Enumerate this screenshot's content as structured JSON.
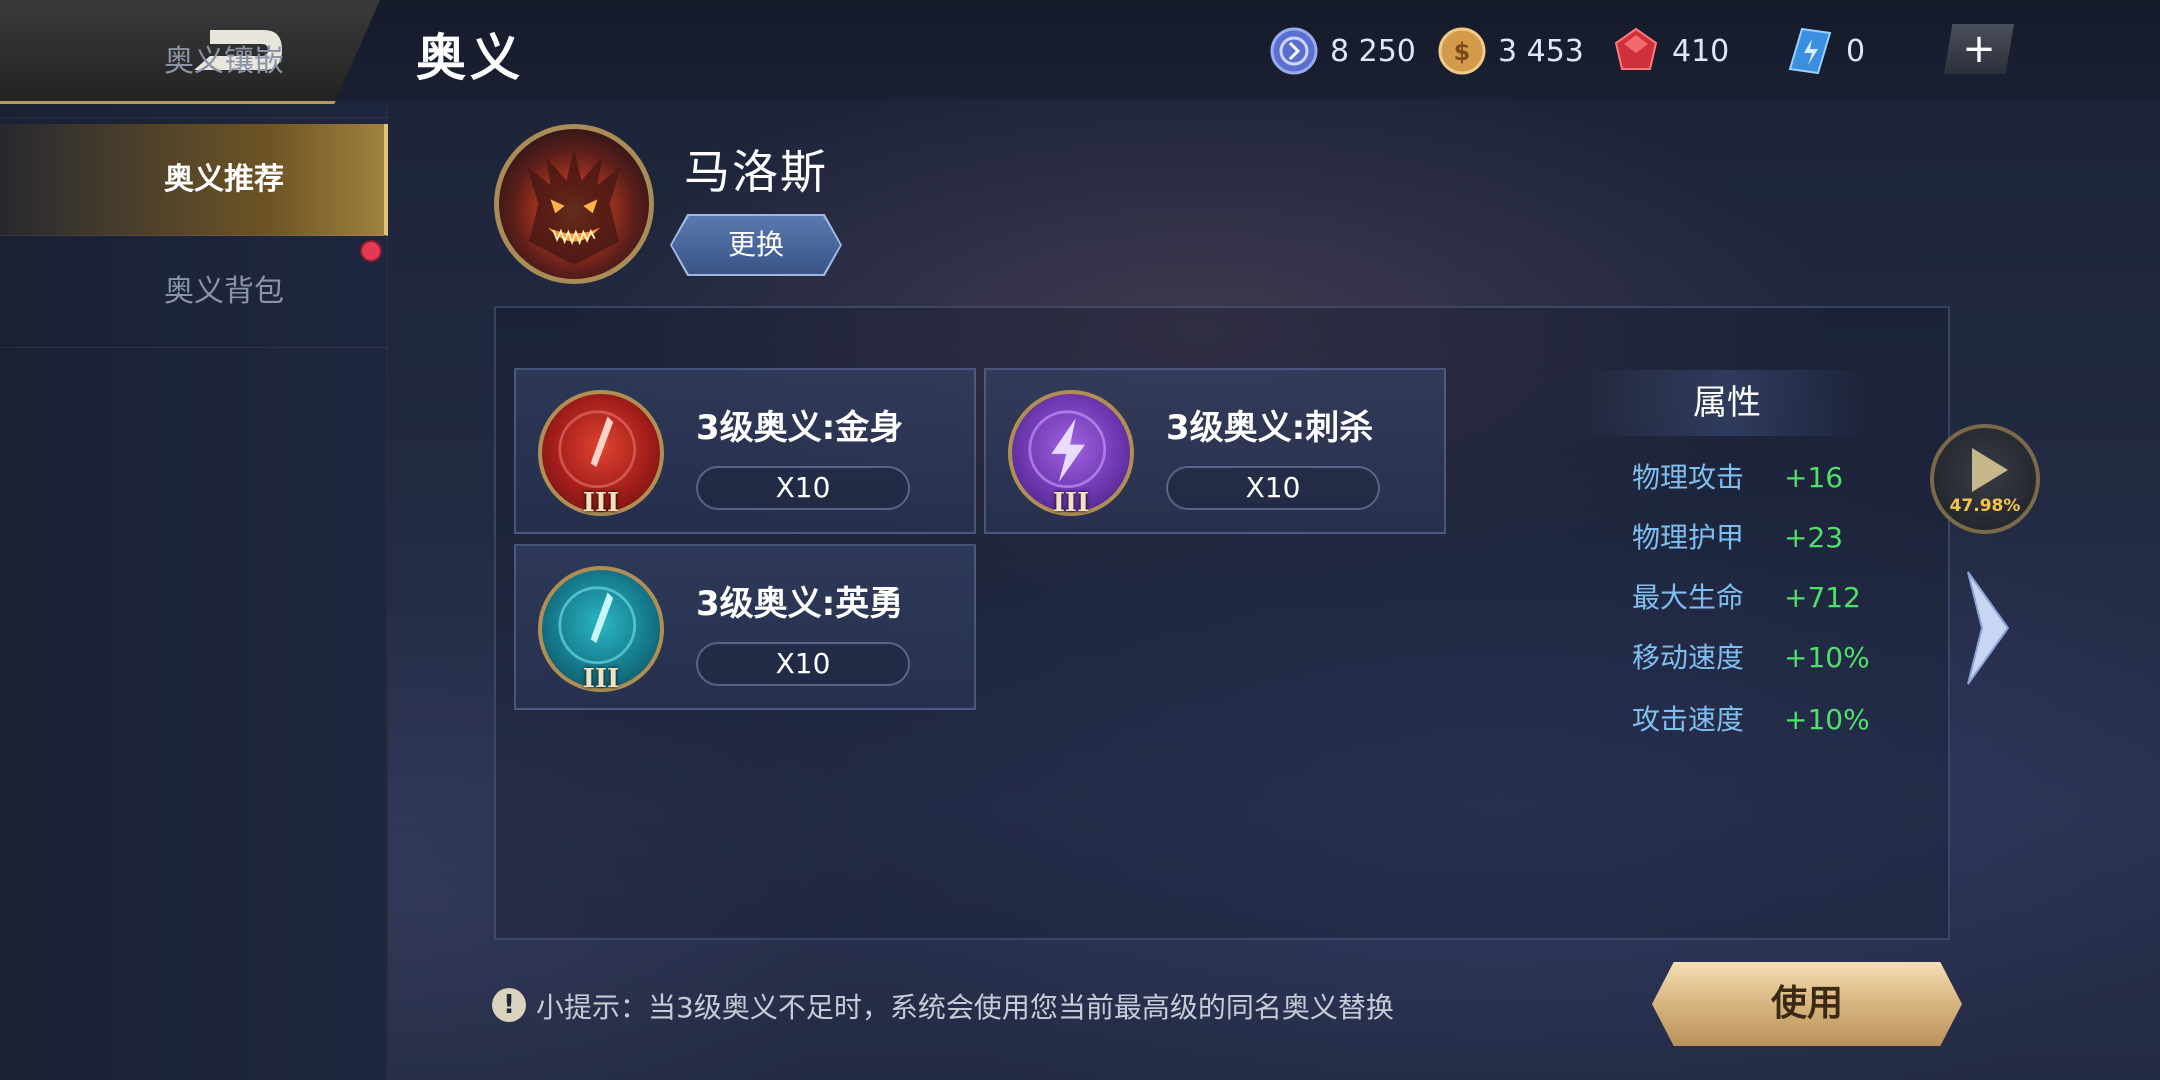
{
  "header": {
    "title": "奥义",
    "back_icon": "back-arrow-icon",
    "currencies": [
      {
        "name": "coupon",
        "icon": "blue-coupon-icon",
        "value": "8 250"
      },
      {
        "name": "gold",
        "icon": "gold-coin-icon",
        "value": "3 453"
      },
      {
        "name": "diamond",
        "icon": "red-gem-icon",
        "value": "410"
      },
      {
        "name": "crystal",
        "icon": "blue-crystal-icon",
        "value": "0"
      }
    ],
    "plus_label": "+"
  },
  "sidebar": {
    "items": [
      {
        "label": "奥义镶嵌",
        "active": false
      },
      {
        "label": "奥义推荐",
        "active": true
      },
      {
        "label": "奥义背包",
        "active": false,
        "notification": true
      }
    ]
  },
  "hero": {
    "name": "马洛斯",
    "change_label": "更换"
  },
  "runes": [
    {
      "name": "3级奥义:金身",
      "quantity": "X10",
      "level": "III",
      "color": "#c0302a"
    },
    {
      "name": "3级奥义:刺杀",
      "quantity": "X10",
      "level": "III",
      "color": "#7a45c0"
    },
    {
      "name": "3级奥义:英勇",
      "quantity": "X10",
      "level": "III",
      "color": "#1a8fa0"
    }
  ],
  "attributes": {
    "title": "属性",
    "rows": [
      {
        "name": "物理攻击",
        "value": "+16"
      },
      {
        "name": "物理护甲",
        "value": "+23"
      },
      {
        "name": "最大生命",
        "value": "+712"
      },
      {
        "name": "移动速度",
        "value": "+10%"
      },
      {
        "name": "攻击速度",
        "value": "+10%"
      }
    ]
  },
  "side_controls": {
    "play_percent": "47.98%"
  },
  "footer": {
    "tip": "小提示：当3级奥义不足时，系统会使用您当前最高级的同名奥义替换",
    "use_label": "使用"
  }
}
